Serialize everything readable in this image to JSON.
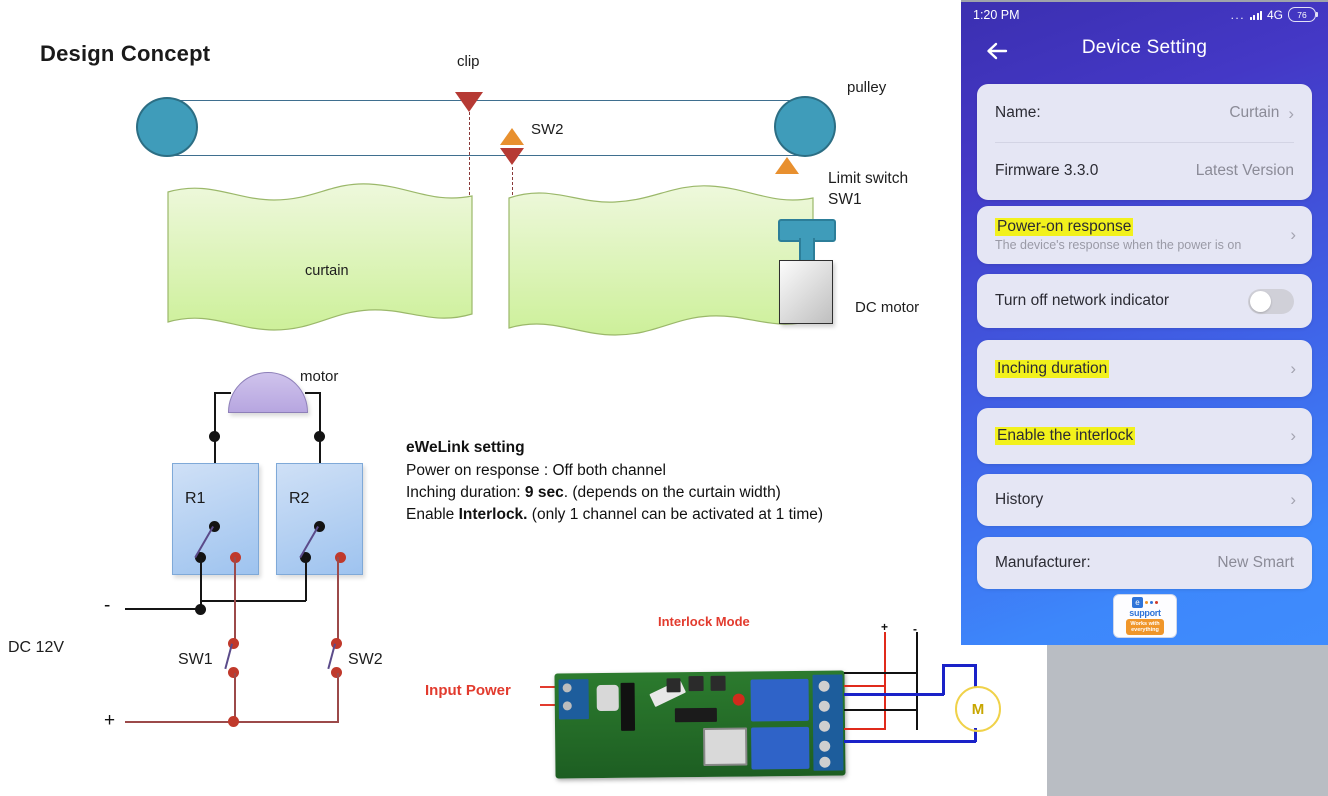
{
  "diagram": {
    "title": "Design Concept",
    "labels": {
      "clip": "clip",
      "pulley": "pulley",
      "sw2": "SW2",
      "limit_switch": "Limit switch\nSW1",
      "curtain": "curtain",
      "dc_motor": "DC motor",
      "motor": "motor",
      "relay1": "R1",
      "relay2": "R2",
      "supply": "DC 12V",
      "minus": "-",
      "plus": "+",
      "sw1_circuit": "SW1",
      "sw2_circuit": "SW2"
    }
  },
  "ewelink_setting": {
    "heading": "eWeLink setting",
    "line1": "Power on response : Off both channel",
    "line2_pre": "Inching duration: ",
    "line2_bold": "9 sec",
    "line2_post": ". (depends on the curtain width)",
    "line3_pre": "Enable ",
    "line3_bold": "Interlock.",
    "line3_post": " (only 1 channel can be activated at 1 time)"
  },
  "photo": {
    "interlock_mode": "Interlock Mode",
    "input_power": "Input Power",
    "motor_symbol": "M",
    "plus": "+",
    "minus": "-"
  },
  "phone": {
    "statusbar": {
      "time": "1:20 PM",
      "dots": "...",
      "network": "4G",
      "battery": "76"
    },
    "appbar": {
      "title": "Device Setting",
      "back_icon": "back-arrow-icon"
    },
    "rows": {
      "name_label": "Name:",
      "name_value": "Curtain",
      "firmware_label": "Firmware  3.3.0",
      "firmware_value": "Latest Version",
      "power_on_response": "Power-on response",
      "power_on_response_sub": "The device's response when the power is on",
      "network_indicator": "Turn off network indicator",
      "inching_duration": "Inching duration",
      "enable_interlock": "Enable the interlock",
      "history": "History",
      "manufacturer_label": "Manufacturer:",
      "manufacturer_value": "New Smart"
    },
    "badge": {
      "e": "e",
      "support": "support",
      "works": "Works with",
      "everything": "everything"
    },
    "chevron": "›",
    "highlight_color": "#f2f11c",
    "card_color": "#e5e6f4",
    "accent_color": "#3f63e8"
  }
}
